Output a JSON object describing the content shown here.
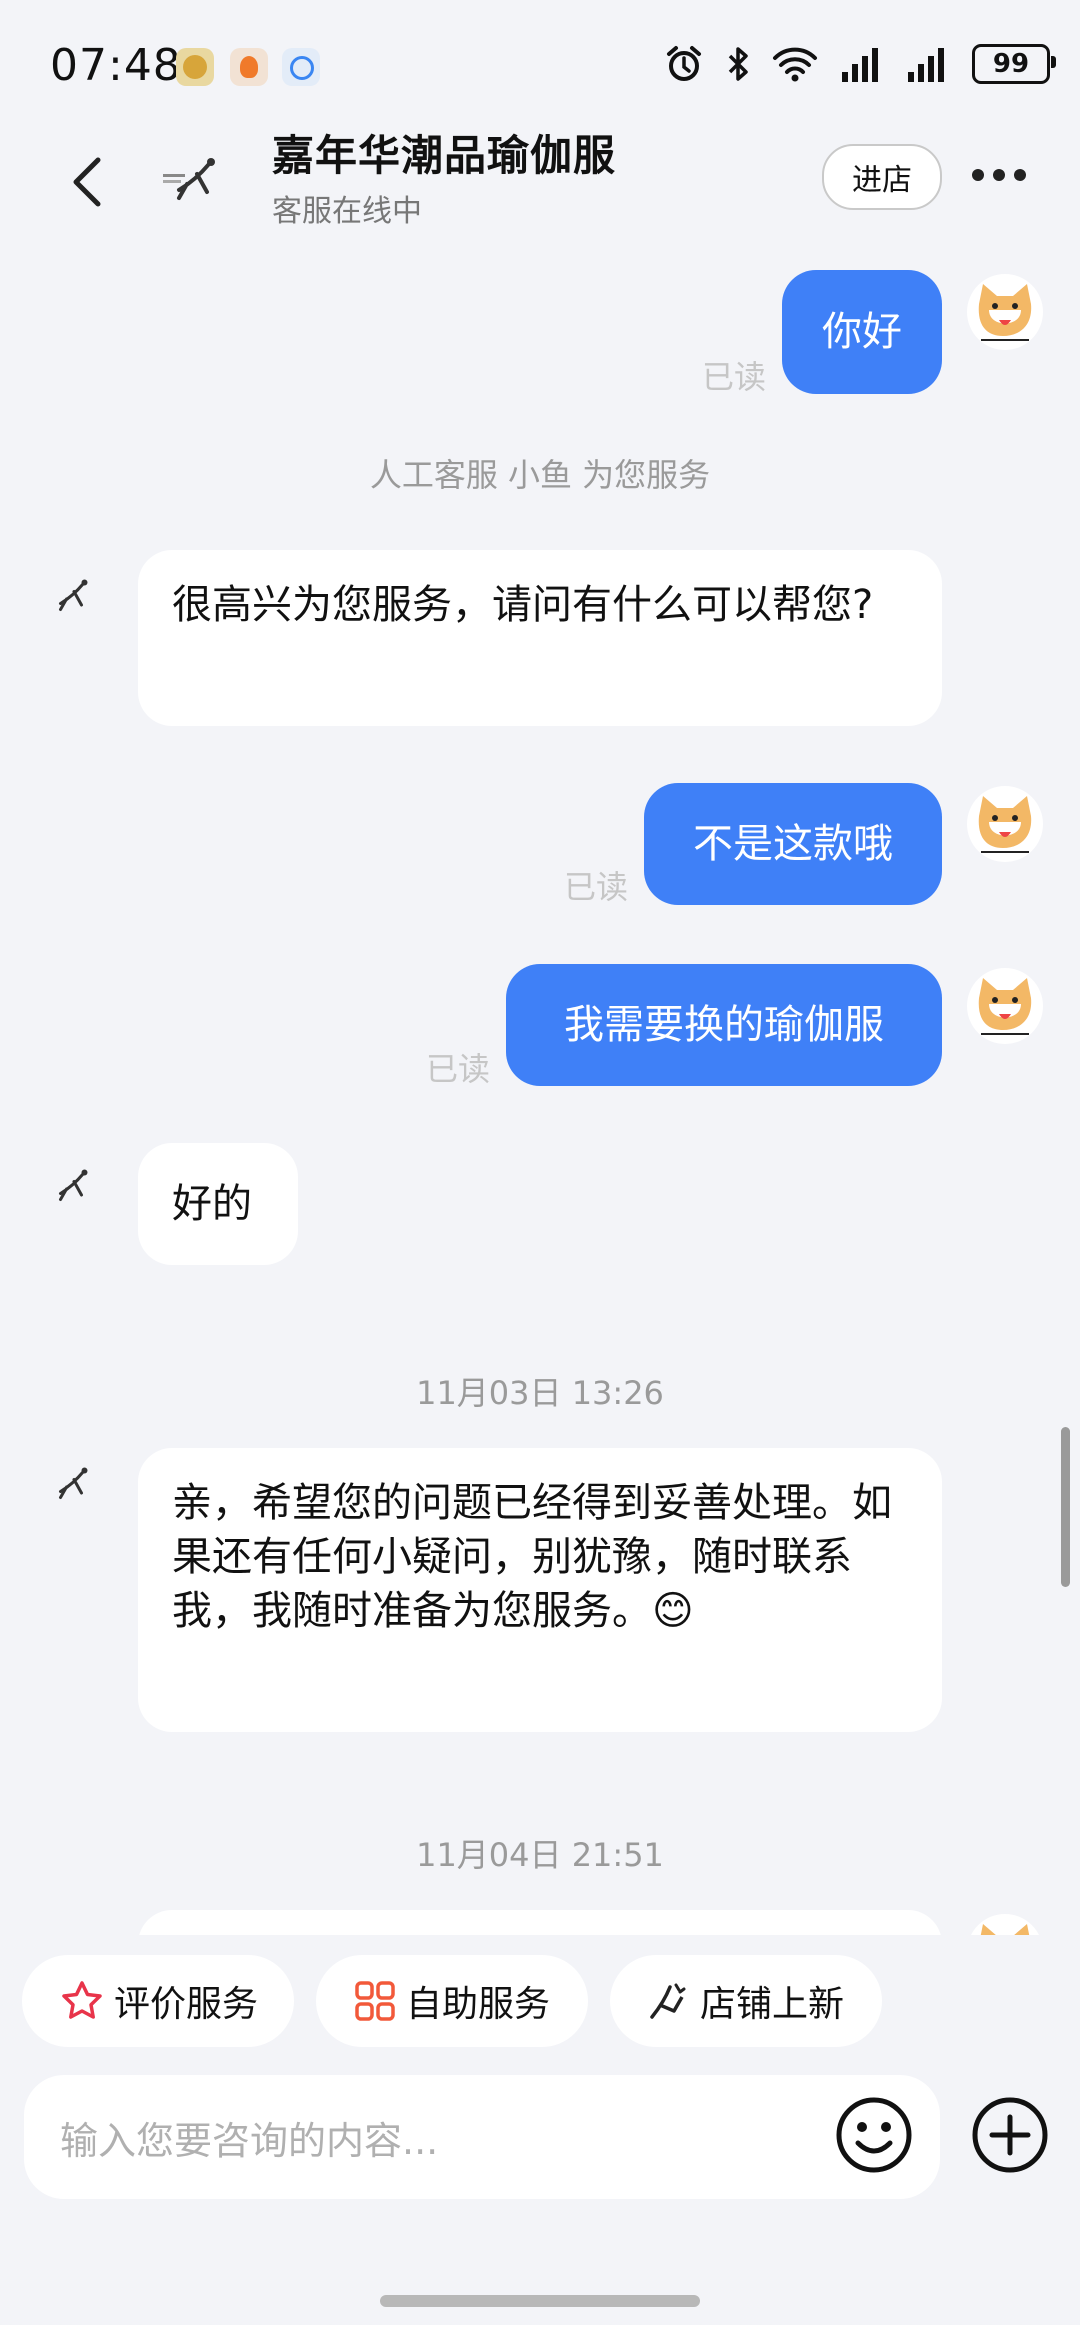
{
  "status_bar": {
    "time": "07:48",
    "battery": "99"
  },
  "header": {
    "title": "嘉年华潮品瑜伽服",
    "subtitle": "客服在线中",
    "enter_label": "进店"
  },
  "messages": {
    "m1": {
      "text": "你好",
      "read": "已读"
    },
    "note1": "人工客服 小鱼 为您服务",
    "m2": {
      "text": "很高兴为您服务，请问有什么可以帮您?"
    },
    "m3": {
      "text": "不是这款哦",
      "read": "已读"
    },
    "m4": {
      "text": "我需要换的瑜伽服",
      "read": "已读"
    },
    "m5": {
      "text": "好的"
    },
    "time1": "11月03日 13:26",
    "m6": {
      "text": "亲，希望您的问题已经得到妥善处理。如果还有任何小疑问，别犹豫，随时联系我，我随时准备为您服务。😊"
    },
    "time2": "11月04日 21:51"
  },
  "quick_actions": [
    {
      "label": "评价服务",
      "icon": "star-icon"
    },
    {
      "label": "自助服务",
      "icon": "grid-icon"
    },
    {
      "label": "店铺上新",
      "icon": "new-arrivals-icon"
    }
  ],
  "input": {
    "placeholder": "输入您要咨询的内容..."
  },
  "colors": {
    "my_bubble": "#3f80f7",
    "background": "#f3f4f8",
    "star_accent": "#e8344a"
  }
}
